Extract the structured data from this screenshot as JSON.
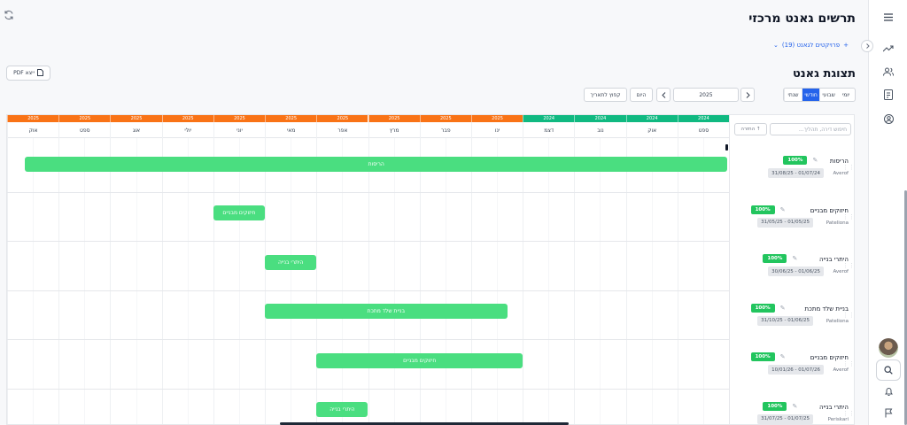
{
  "header": {
    "title": "תרשים גאנט מרכזי",
    "projects_link": "פרויקטים לגאנט (19)",
    "section_title": "תצוגת גאנט",
    "pdf_label": "PDF ייצא"
  },
  "toolbar": {
    "view_modes": [
      "יומי",
      "שבועי",
      "חודשי",
      "שנתי"
    ],
    "active_view": "חודשי",
    "year": "2025",
    "today_label": "היום",
    "jump_label": "קפוץ לתאריך"
  },
  "panel": {
    "search_placeholder": "חיפוש דירה, תהליך...",
    "add_label": "החזרה ↑"
  },
  "timeline": {
    "years": [
      "2025",
      "2025",
      "2025",
      "2025",
      "2025",
      "2025",
      "2025",
      "2025",
      "2025",
      "2025",
      "2024",
      "2024",
      "2024",
      "2024"
    ],
    "months": [
      "אוק",
      "ספט",
      "אוג",
      "יולי",
      "יוני",
      "מאי",
      "אפר",
      "מרץ",
      "פבר",
      "ינו",
      "דצמ",
      "נוב",
      "אוק",
      "ספט"
    ],
    "colors": {
      "y2025": "#f97316",
      "y2024": "#10b981"
    }
  },
  "tasks": [
    {
      "name": "הריסות",
      "progress": "100%",
      "dates": "31/08/25 - 01/07/24",
      "owner": "Averof",
      "bar_label": "הריסות",
      "start_month": 0.35,
      "end_month": 14.0
    },
    {
      "name": "חיזוקים מבניים",
      "progress": "100%",
      "dates": "31/05/25 - 01/05/25",
      "owner": "Pateliona",
      "bar_label": "חיזוקים מבניים",
      "start_month": 4.0,
      "end_month": 5.0
    },
    {
      "name": "היתרי בנייה",
      "progress": "100%",
      "dates": "30/06/25 - 01/06/25",
      "owner": "Averof",
      "bar_label": "היתרי בנייה",
      "start_month": 5.0,
      "end_month": 6.0
    },
    {
      "name": "בניית שלד מתכת",
      "progress": "100%",
      "dates": "31/10/25 - 01/06/25",
      "owner": "Pateliona",
      "bar_label": "בניית שלד מתכת",
      "start_month": 5.0,
      "end_month": 9.7
    },
    {
      "name": "חיזוקים מבניים",
      "progress": "100%",
      "dates": "10/01/26 - 01/07/26",
      "owner": "Averof",
      "bar_label": "חיזוקים מבניים",
      "start_month": 6.0,
      "end_month": 10.0
    },
    {
      "name": "היתרי בנייה",
      "progress": "100%",
      "dates": "31/07/25 - 01/07/25",
      "owner": "Periskari",
      "bar_label": "היתרי בנייה",
      "start_month": 6.0,
      "end_month": 7.0
    }
  ]
}
